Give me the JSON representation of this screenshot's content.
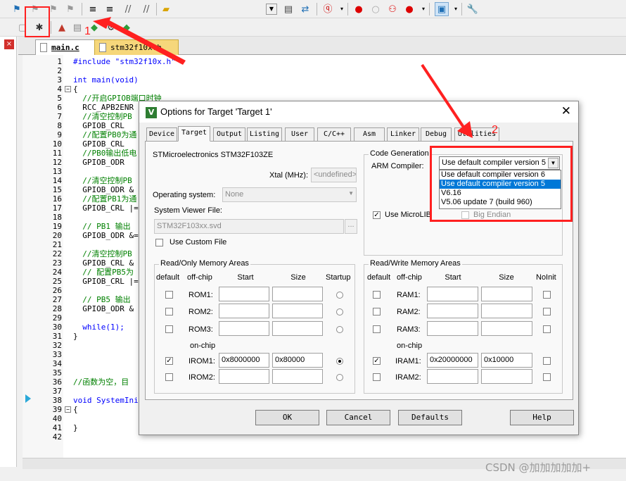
{
  "tabs": {
    "main_c": "main.c",
    "stm32_h": "stm32f10x.h"
  },
  "code": {
    "line_numbers": [
      "1",
      "2",
      "3",
      "4",
      "5",
      "6",
      "7",
      "8",
      "9",
      "10",
      "11",
      "12",
      "13",
      "14",
      "15",
      "16",
      "17",
      "18",
      "19",
      "20",
      "21",
      "22",
      "23",
      "24",
      "25",
      "26",
      "27",
      "28",
      "29",
      "30",
      "31",
      "32",
      "33",
      "34",
      "35",
      "36",
      "37",
      "38",
      "39",
      "40",
      "41",
      "42"
    ],
    "lines": [
      "#include \"stm32f10x.h\"",
      "",
      "int main(void)",
      "{",
      "  //开启GPIOB端口时钟",
      "  RCC_APB2ENR",
      "  //清空控制PB",
      "  GPIOB_CRL",
      "  //配置PB0为通",
      "  GPIOB_CRL",
      "  //PB0输出低电",
      "  GPIOB_ODR",
      "",
      "  //清空控制PB",
      "  GPIOB_ODR &",
      "  //配置PB1为通",
      "  GPIOB_CRL |=",
      "",
      "  // PB1 输出",
      "  GPIOB_ODR &=",
      "",
      "  //清空控制PB",
      "  GPIOB_CRL &",
      "  // 配置PB5为",
      "  GPIOB_CRL |=",
      "",
      "  // PB5 输出",
      "  GPIOB_ODR &",
      "",
      "  while(1);",
      "}",
      "",
      "",
      "",
      "",
      "//函数为空，目",
      "",
      "void SystemIni",
      "{",
      "",
      "}",
      ""
    ]
  },
  "dialog": {
    "title": "Options for Target 'Target 1'",
    "close": "✕",
    "tabs": [
      "Device",
      "Target",
      "Output",
      "Listing",
      "User",
      "C/C++",
      "Asm",
      "Linker",
      "Debug",
      "Utilities"
    ],
    "device_name": "STMicroelectronics STM32F103ZE",
    "xtal_label": "Xtal (MHz):",
    "xtal_value": "<undefined>",
    "os_label": "Operating system:",
    "os_value": "None",
    "svd_label": "System Viewer File:",
    "svd_value": "STM32F103xx.svd",
    "svd_browse": "...",
    "custom_file_label": "Use Custom File",
    "codegen": {
      "group": "Code Generation",
      "compiler_label": "ARM Compiler:",
      "selected": "Use default compiler version 5",
      "options": [
        "Use default compiler version 6",
        "Use default compiler version 5",
        "V6.16",
        "V5.06 update 7 (build 960)"
      ],
      "microlib_label": "Use MicroLIB",
      "big_endian_label": "Big Endian"
    },
    "ro": {
      "group": "Read/Only Memory Areas",
      "headers": {
        "default": "default",
        "offchip": "off-chip",
        "start": "Start",
        "size": "Size",
        "startup": "Startup"
      },
      "onchip_label": "on-chip",
      "rows": [
        {
          "name": "ROM1:",
          "start": "",
          "size": ""
        },
        {
          "name": "ROM2:",
          "start": "",
          "size": ""
        },
        {
          "name": "ROM3:",
          "start": "",
          "size": ""
        },
        {
          "name": "IROM1:",
          "start": "0x8000000",
          "size": "0x80000"
        },
        {
          "name": "IROM2:",
          "start": "",
          "size": ""
        }
      ]
    },
    "rw": {
      "group": "Read/Write Memory Areas",
      "headers": {
        "default": "default",
        "offchip": "off-chip",
        "start": "Start",
        "size": "Size",
        "noinit": "NoInit"
      },
      "onchip_label": "on-chip",
      "rows": [
        {
          "name": "RAM1:",
          "start": "",
          "size": ""
        },
        {
          "name": "RAM2:",
          "start": "",
          "size": ""
        },
        {
          "name": "RAM3:",
          "start": "",
          "size": ""
        },
        {
          "name": "IRAM1:",
          "start": "0x20000000",
          "size": "0x10000"
        },
        {
          "name": "IRAM2:",
          "start": "",
          "size": ""
        }
      ]
    },
    "buttons": {
      "ok": "OK",
      "cancel": "Cancel",
      "defaults": "Defaults",
      "help": "Help"
    }
  },
  "annotations": {
    "step1": "1",
    "step2": "2",
    "color": "#ff2020"
  },
  "watermark": "CSDN @加加加加加+"
}
